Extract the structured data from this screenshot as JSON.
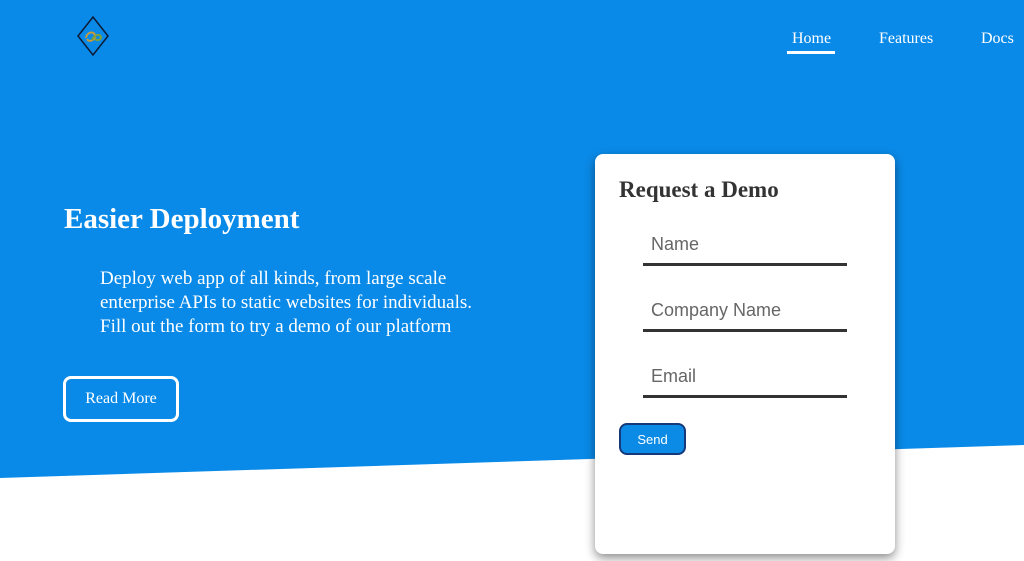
{
  "colors": {
    "hero_background": "#0a8ae8",
    "card_background": "#ffffff",
    "text_dark": "#333333",
    "send_button_background": "#0b8be6",
    "send_button_border": "#15397a"
  },
  "logo": {
    "icon": "diamond-logo-icon"
  },
  "nav": {
    "items": [
      {
        "label": "Home",
        "active": true
      },
      {
        "label": "Features",
        "active": false
      },
      {
        "label": "Docs",
        "active": false
      }
    ]
  },
  "hero": {
    "title": "Easier Deployment",
    "description_lines": [
      "Deploy web app of all kinds, from large scale",
      "enterprise APIs to static websites for individuals.",
      "Fill out the form to try a demo of our platform"
    ],
    "read_more_label": "Read More"
  },
  "demo_form": {
    "title": "Request a Demo",
    "fields": [
      {
        "placeholder": "Name",
        "value": ""
      },
      {
        "placeholder": "Company Name",
        "value": ""
      },
      {
        "placeholder": "Email",
        "value": ""
      }
    ],
    "send_label": "Send"
  }
}
